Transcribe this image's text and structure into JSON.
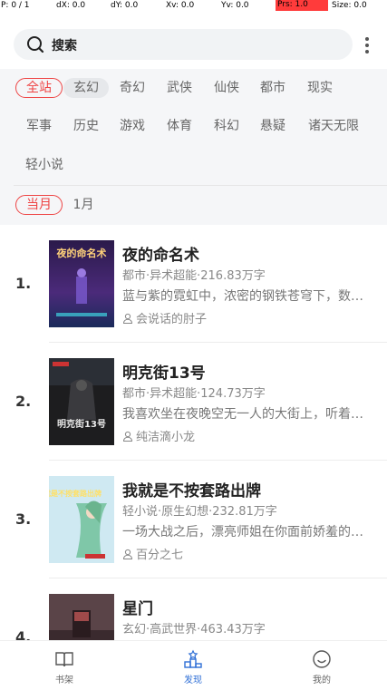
{
  "debug": {
    "p": "P: 0 / 1",
    "dx": "dX: 0.0",
    "dy": "dY: 0.0",
    "xv": "Xv: 0.0",
    "yv": "Yv: 0.0",
    "prs": "Prs: 1.0",
    "size": "Size: 0.0"
  },
  "search": {
    "label": "搜索"
  },
  "categories": {
    "row1": [
      "全站",
      "玄幻",
      "奇幻",
      "武侠",
      "仙侠",
      "都市",
      "现实"
    ],
    "row2": [
      "军事",
      "历史",
      "游戏",
      "体育",
      "科幻",
      "悬疑",
      "诸天无限"
    ],
    "row3": [
      "轻小说"
    ]
  },
  "periods": [
    "当月",
    "1月"
  ],
  "books": [
    {
      "rank": "1.",
      "title": "夜的命名术",
      "meta": "都市·异术超能·216.83万字",
      "desc": "蓝与紫的霓虹中，浓密的钢铁苍穹下，数据洪流的前端，是科技革命之后的世界，也是现实与虚幻的分界。",
      "author": "会说话的肘子",
      "cover_text": "夜的命名术"
    },
    {
      "rank": "2.",
      "title": "明克街13号",
      "meta": "都市·异术超能·124.73万字",
      "desc": "我喜欢坐在夜晚空无一人的大街上，听着周围的声音。",
      "author": "纯洁滴小龙",
      "cover_text": "明克街13号"
    },
    {
      "rank": "3.",
      "title": "我就是不按套路出牌",
      "meta": "轻小说·原生幻想·232.81万字",
      "desc": "一场大战之后，漂亮师姐在你面前娇羞的说道。",
      "author": "百分之七",
      "cover_text": "我就是不按套路出牌"
    },
    {
      "rank": "4.",
      "title": "星门",
      "meta": "玄幻·高武世界·463.43万字",
      "desc": "",
      "author": "",
      "cover_text": ""
    }
  ],
  "tabs": [
    "书架",
    "发现",
    "我的"
  ],
  "colors": {
    "accent": "#ee4444",
    "active_tab": "#2f6fd6"
  }
}
